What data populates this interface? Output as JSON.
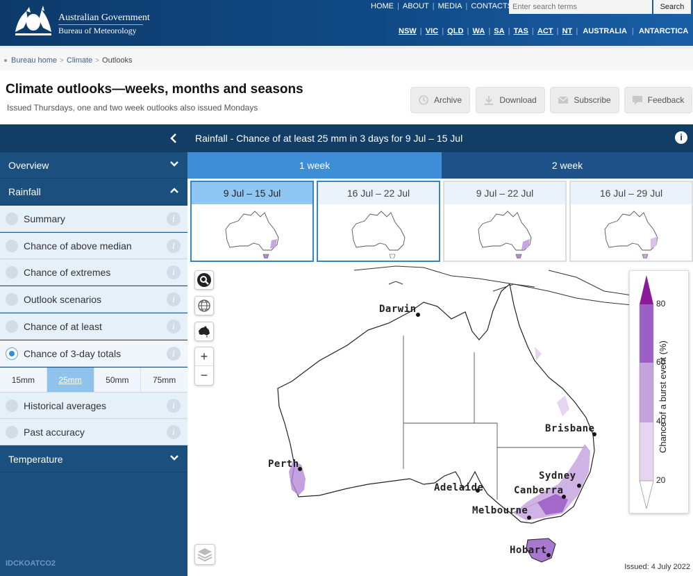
{
  "header": {
    "gov_line1": "Australian Government",
    "gov_line2": "Bureau of Meteorology",
    "topnav": [
      "HOME",
      "ABOUT",
      "MEDIA",
      "CONTACTS"
    ],
    "search_placeholder": "Enter search terms",
    "search_button": "Search",
    "states": [
      "NSW",
      "VIC",
      "QLD",
      "WA",
      "SA",
      "TAS",
      "ACT",
      "NT"
    ],
    "regions": [
      "AUSTRALIA",
      "ANTARCTICA"
    ]
  },
  "breadcrumb": [
    "Bureau home",
    "Climate",
    "Outlooks"
  ],
  "page": {
    "title": "Climate outlooks—weeks, months and seasons",
    "subtitle": "Issued Thursdays, one and two week outlooks also issued Mondays"
  },
  "toolbar": {
    "archive": "Archive",
    "download": "Download",
    "subscribe": "Subscribe",
    "feedback": "Feedback"
  },
  "sidebar": {
    "overview": "Overview",
    "rainfall": "Rainfall",
    "items": [
      {
        "label": "Summary"
      },
      {
        "label": "Chance of above median"
      },
      {
        "label": "Chance of extremes"
      },
      {
        "label": "Outlook scenarios"
      },
      {
        "label": "Chance of at least"
      },
      {
        "label": "Chance of 3-day totals",
        "selected": true
      },
      {
        "label": "Historical averages"
      },
      {
        "label": "Past accuracy"
      }
    ],
    "amounts": [
      "15mm",
      "25mm",
      "50mm",
      "75mm"
    ],
    "selected_amount": "25mm",
    "temperature": "Temperature",
    "product_code": "IDCKOATCO2"
  },
  "panel": {
    "title": "Rainfall - Chance of at least 25 mm in 3 days for 9 Jul – 15 Jul",
    "tabs": [
      "1 week",
      "2 week"
    ],
    "active_tab": "1 week",
    "thumbnails": [
      "9 Jul – 15 Jul",
      "16 Jul – 22 Jul",
      "9 Jul – 22 Jul",
      "16 Jul – 29 Jul"
    ]
  },
  "map": {
    "cities": [
      "Darwin",
      "Brisbane",
      "Perth",
      "Sydney",
      "Adelaide",
      "Canberra",
      "Melbourne",
      "Hobart"
    ],
    "legend_title": "Chance of a burst event (%)",
    "legend_ticks": [
      "80",
      "60",
      "40",
      "20"
    ],
    "legend_colors": [
      "#8b1a9b",
      "#9c5fc6",
      "#c4a2db",
      "#e7d4ee",
      "#ffffff"
    ],
    "issued": "Issued: 4 July 2022"
  },
  "colors": {
    "header_blue": "#104a86",
    "panel_dark": "#123d65",
    "sidebar_blue": "#1b4f7e",
    "tab_active": "#3d8ed6",
    "thumb_selected": "#90c6f2"
  }
}
